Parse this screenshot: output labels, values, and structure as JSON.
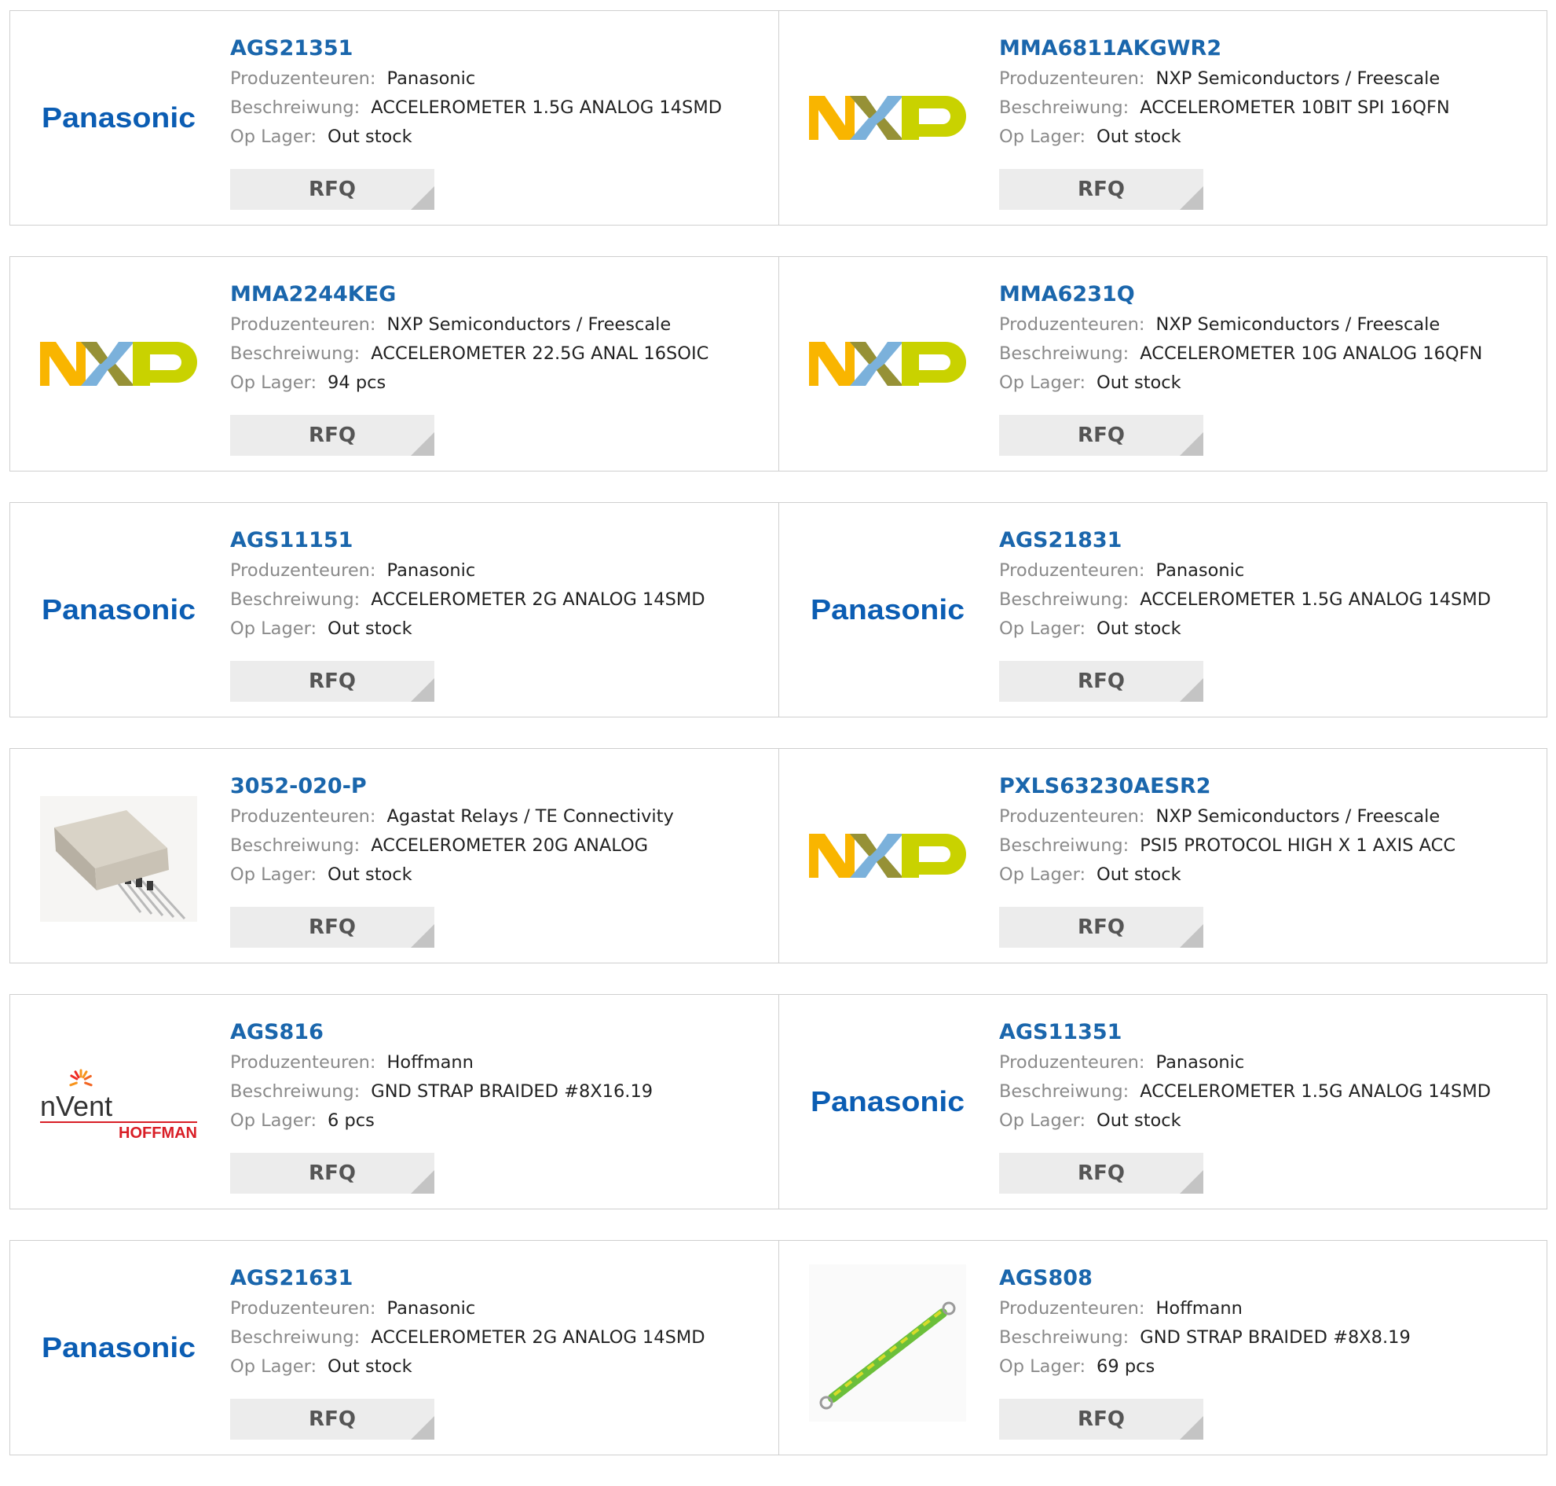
{
  "colors": {
    "part_link": "#1a66ac",
    "label_gray": "#8a8a8a",
    "button_bg": "#ececec",
    "border": "#cfcfcf"
  },
  "labels": {
    "manufacturer": "Produzenteuren:",
    "description": "Beschreiwung:",
    "stock": "Op Lager:",
    "rfq": "RFQ"
  },
  "products": [
    {
      "part": "AGS21351",
      "manufacturer": "Panasonic",
      "description": "ACCELEROMETER 1.5G ANALOG 14SMD",
      "stock": "Out stock",
      "logo": "panasonic-logo",
      "logo_text": "Panasonic"
    },
    {
      "part": "MMA6811AKGWR2",
      "manufacturer": "NXP Semiconductors / Freescale",
      "description": "ACCELEROMETER 10BIT SPI 16QFN",
      "stock": "Out stock",
      "logo": "nxp-logo"
    },
    {
      "part": "MMA2244KEG",
      "manufacturer": "NXP Semiconductors / Freescale",
      "description": "ACCELEROMETER 22.5G ANAL 16SOIC",
      "stock": "94 pcs",
      "logo": "nxp-logo"
    },
    {
      "part": "MMA6231Q",
      "manufacturer": "NXP Semiconductors / Freescale",
      "description": "ACCELEROMETER 10G ANALOG 16QFN",
      "stock": "Out stock",
      "logo": "nxp-logo"
    },
    {
      "part": "AGS11151",
      "manufacturer": "Panasonic",
      "description": "ACCELEROMETER 2G ANALOG 14SMD",
      "stock": "Out stock",
      "logo": "panasonic-logo",
      "logo_text": "Panasonic"
    },
    {
      "part": "AGS21831",
      "manufacturer": "Panasonic",
      "description": "ACCELEROMETER 1.5G ANALOG 14SMD",
      "stock": "Out stock",
      "logo": "panasonic-logo",
      "logo_text": "Panasonic"
    },
    {
      "part": "3052-020-P",
      "manufacturer": "Agastat Relays / TE Connectivity",
      "description": "ACCELEROMETER 20G ANALOG",
      "stock": "Out stock",
      "logo": "component-package-photo"
    },
    {
      "part": "PXLS63230AESR2",
      "manufacturer": "NXP Semiconductors / Freescale",
      "description": "PSI5 PROTOCOL HIGH X 1 AXIS ACC",
      "stock": "Out stock",
      "logo": "nxp-logo"
    },
    {
      "part": "AGS816",
      "manufacturer": "Hoffmann",
      "description": "GND STRAP BRAIDED #8X16.19",
      "stock": "6 pcs",
      "logo": "nvent-hoffman-logo",
      "logo_text": "nVent",
      "logo_subtext": "HOFFMAN"
    },
    {
      "part": "AGS11351",
      "manufacturer": "Panasonic",
      "description": "ACCELEROMETER 1.5G ANALOG 14SMD",
      "stock": "Out stock",
      "logo": "panasonic-logo",
      "logo_text": "Panasonic"
    },
    {
      "part": "AGS21631",
      "manufacturer": "Panasonic",
      "description": "ACCELEROMETER 2G ANALOG 14SMD",
      "stock": "Out stock",
      "logo": "panasonic-logo",
      "logo_text": "Panasonic"
    },
    {
      "part": "AGS808",
      "manufacturer": "Hoffmann",
      "description": "GND STRAP BRAIDED #8X8.19",
      "stock": "69 pcs",
      "logo": "ground-strap-photo"
    }
  ]
}
